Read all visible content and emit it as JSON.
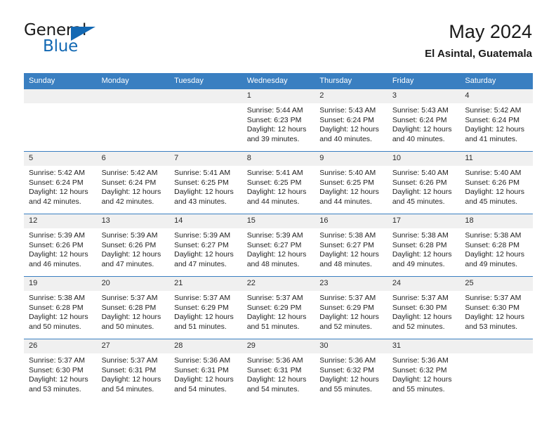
{
  "brand": {
    "name_primary": "General",
    "name_secondary": "Blue",
    "accent_color": "#1268b3",
    "logo_icon": "triangle-icon"
  },
  "header": {
    "title": "May 2024",
    "subtitle": "El Asintal, Guatemala"
  },
  "calendar": {
    "header_bg": "#3a7fc1",
    "daynum_bg": "#f0f0f0",
    "weekday_headers": [
      "Sunday",
      "Monday",
      "Tuesday",
      "Wednesday",
      "Thursday",
      "Friday",
      "Saturday"
    ],
    "labels": {
      "sunrise": "Sunrise:",
      "sunset": "Sunset:",
      "daylight": "Daylight:"
    },
    "weeks": [
      [
        {
          "day": "",
          "empty": true,
          "sunrise": "",
          "sunset": "",
          "daylight": ""
        },
        {
          "day": "",
          "empty": true,
          "sunrise": "",
          "sunset": "",
          "daylight": ""
        },
        {
          "day": "",
          "empty": true,
          "sunrise": "",
          "sunset": "",
          "daylight": ""
        },
        {
          "day": "1",
          "empty": false,
          "sunrise": "Sunrise: 5:44 AM",
          "sunset": "Sunset: 6:23 PM",
          "daylight": "Daylight: 12 hours and 39 minutes."
        },
        {
          "day": "2",
          "empty": false,
          "sunrise": "Sunrise: 5:43 AM",
          "sunset": "Sunset: 6:24 PM",
          "daylight": "Daylight: 12 hours and 40 minutes."
        },
        {
          "day": "3",
          "empty": false,
          "sunrise": "Sunrise: 5:43 AM",
          "sunset": "Sunset: 6:24 PM",
          "daylight": "Daylight: 12 hours and 40 minutes."
        },
        {
          "day": "4",
          "empty": false,
          "sunrise": "Sunrise: 5:42 AM",
          "sunset": "Sunset: 6:24 PM",
          "daylight": "Daylight: 12 hours and 41 minutes."
        }
      ],
      [
        {
          "day": "5",
          "empty": false,
          "sunrise": "Sunrise: 5:42 AM",
          "sunset": "Sunset: 6:24 PM",
          "daylight": "Daylight: 12 hours and 42 minutes."
        },
        {
          "day": "6",
          "empty": false,
          "sunrise": "Sunrise: 5:42 AM",
          "sunset": "Sunset: 6:24 PM",
          "daylight": "Daylight: 12 hours and 42 minutes."
        },
        {
          "day": "7",
          "empty": false,
          "sunrise": "Sunrise: 5:41 AM",
          "sunset": "Sunset: 6:25 PM",
          "daylight": "Daylight: 12 hours and 43 minutes."
        },
        {
          "day": "8",
          "empty": false,
          "sunrise": "Sunrise: 5:41 AM",
          "sunset": "Sunset: 6:25 PM",
          "daylight": "Daylight: 12 hours and 44 minutes."
        },
        {
          "day": "9",
          "empty": false,
          "sunrise": "Sunrise: 5:40 AM",
          "sunset": "Sunset: 6:25 PM",
          "daylight": "Daylight: 12 hours and 44 minutes."
        },
        {
          "day": "10",
          "empty": false,
          "sunrise": "Sunrise: 5:40 AM",
          "sunset": "Sunset: 6:26 PM",
          "daylight": "Daylight: 12 hours and 45 minutes."
        },
        {
          "day": "11",
          "empty": false,
          "sunrise": "Sunrise: 5:40 AM",
          "sunset": "Sunset: 6:26 PM",
          "daylight": "Daylight: 12 hours and 45 minutes."
        }
      ],
      [
        {
          "day": "12",
          "empty": false,
          "sunrise": "Sunrise: 5:39 AM",
          "sunset": "Sunset: 6:26 PM",
          "daylight": "Daylight: 12 hours and 46 minutes."
        },
        {
          "day": "13",
          "empty": false,
          "sunrise": "Sunrise: 5:39 AM",
          "sunset": "Sunset: 6:26 PM",
          "daylight": "Daylight: 12 hours and 47 minutes."
        },
        {
          "day": "14",
          "empty": false,
          "sunrise": "Sunrise: 5:39 AM",
          "sunset": "Sunset: 6:27 PM",
          "daylight": "Daylight: 12 hours and 47 minutes."
        },
        {
          "day": "15",
          "empty": false,
          "sunrise": "Sunrise: 5:39 AM",
          "sunset": "Sunset: 6:27 PM",
          "daylight": "Daylight: 12 hours and 48 minutes."
        },
        {
          "day": "16",
          "empty": false,
          "sunrise": "Sunrise: 5:38 AM",
          "sunset": "Sunset: 6:27 PM",
          "daylight": "Daylight: 12 hours and 48 minutes."
        },
        {
          "day": "17",
          "empty": false,
          "sunrise": "Sunrise: 5:38 AM",
          "sunset": "Sunset: 6:28 PM",
          "daylight": "Daylight: 12 hours and 49 minutes."
        },
        {
          "day": "18",
          "empty": false,
          "sunrise": "Sunrise: 5:38 AM",
          "sunset": "Sunset: 6:28 PM",
          "daylight": "Daylight: 12 hours and 49 minutes."
        }
      ],
      [
        {
          "day": "19",
          "empty": false,
          "sunrise": "Sunrise: 5:38 AM",
          "sunset": "Sunset: 6:28 PM",
          "daylight": "Daylight: 12 hours and 50 minutes."
        },
        {
          "day": "20",
          "empty": false,
          "sunrise": "Sunrise: 5:37 AM",
          "sunset": "Sunset: 6:28 PM",
          "daylight": "Daylight: 12 hours and 50 minutes."
        },
        {
          "day": "21",
          "empty": false,
          "sunrise": "Sunrise: 5:37 AM",
          "sunset": "Sunset: 6:29 PM",
          "daylight": "Daylight: 12 hours and 51 minutes."
        },
        {
          "day": "22",
          "empty": false,
          "sunrise": "Sunrise: 5:37 AM",
          "sunset": "Sunset: 6:29 PM",
          "daylight": "Daylight: 12 hours and 51 minutes."
        },
        {
          "day": "23",
          "empty": false,
          "sunrise": "Sunrise: 5:37 AM",
          "sunset": "Sunset: 6:29 PM",
          "daylight": "Daylight: 12 hours and 52 minutes."
        },
        {
          "day": "24",
          "empty": false,
          "sunrise": "Sunrise: 5:37 AM",
          "sunset": "Sunset: 6:30 PM",
          "daylight": "Daylight: 12 hours and 52 minutes."
        },
        {
          "day": "25",
          "empty": false,
          "sunrise": "Sunrise: 5:37 AM",
          "sunset": "Sunset: 6:30 PM",
          "daylight": "Daylight: 12 hours and 53 minutes."
        }
      ],
      [
        {
          "day": "26",
          "empty": false,
          "sunrise": "Sunrise: 5:37 AM",
          "sunset": "Sunset: 6:30 PM",
          "daylight": "Daylight: 12 hours and 53 minutes."
        },
        {
          "day": "27",
          "empty": false,
          "sunrise": "Sunrise: 5:37 AM",
          "sunset": "Sunset: 6:31 PM",
          "daylight": "Daylight: 12 hours and 54 minutes."
        },
        {
          "day": "28",
          "empty": false,
          "sunrise": "Sunrise: 5:36 AM",
          "sunset": "Sunset: 6:31 PM",
          "daylight": "Daylight: 12 hours and 54 minutes."
        },
        {
          "day": "29",
          "empty": false,
          "sunrise": "Sunrise: 5:36 AM",
          "sunset": "Sunset: 6:31 PM",
          "daylight": "Daylight: 12 hours and 54 minutes."
        },
        {
          "day": "30",
          "empty": false,
          "sunrise": "Sunrise: 5:36 AM",
          "sunset": "Sunset: 6:32 PM",
          "daylight": "Daylight: 12 hours and 55 minutes."
        },
        {
          "day": "31",
          "empty": false,
          "sunrise": "Sunrise: 5:36 AM",
          "sunset": "Sunset: 6:32 PM",
          "daylight": "Daylight: 12 hours and 55 minutes."
        },
        {
          "day": "",
          "empty": true,
          "sunrise": "",
          "sunset": "",
          "daylight": ""
        }
      ]
    ]
  }
}
